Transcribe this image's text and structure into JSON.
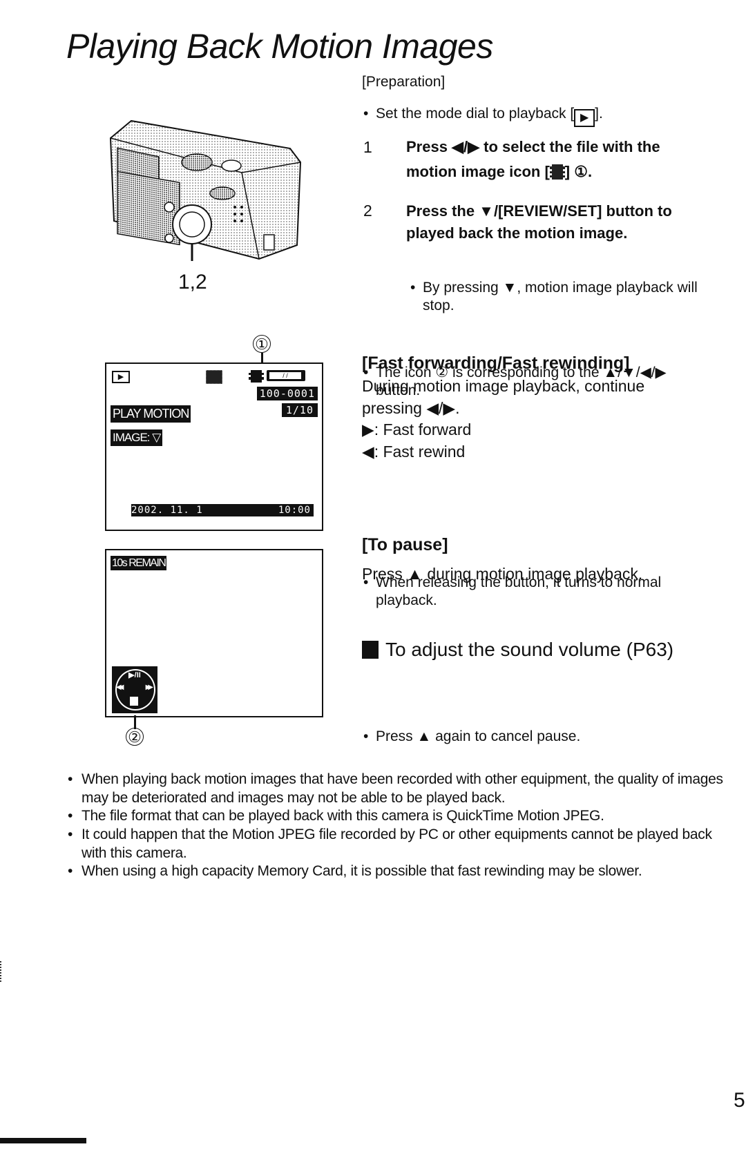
{
  "title": "Playing Back Motion Images",
  "preparation": {
    "label": "[Preparation]",
    "bullet": "Set the mode dial to playback [",
    "bullet_icon": "▶",
    "bullet_end": "]."
  },
  "steps": [
    {
      "num": "1",
      "text_a": "Press ◀/▶ to select the file with the",
      "text_b": "motion image icon [",
      "icon": "film-icon",
      "text_c": "] ①."
    },
    {
      "num": "2",
      "text_a": "Press the ▼/[REVIEW/SET] button to",
      "text_b": "played back the motion image.",
      "sub_bullet_a": "By pressing ▼, motion image playback will",
      "sub_bullet_b": "stop."
    }
  ],
  "icon_note_a": "The icon ② is corresponding to the ▲/▼/◀/▶",
  "icon_note_b": "button.",
  "fast": {
    "heading": "[Fast forwarding/Fast rewinding]",
    "line1": "During motion image playback, continue",
    "line2": "pressing ◀/▶.",
    "ff": "▶: Fast forward",
    "rw": "◀: Fast rewind",
    "note_a": "When releasing the button, it turns to normal",
    "note_b": "playback."
  },
  "pause": {
    "heading": "[To pause]",
    "line": "Press ▲ during motion image playback.",
    "note": "Press ▲ again to cancel pause."
  },
  "volume": {
    "text": "To adjust the sound volume (P63)"
  },
  "camera": {
    "callout_label": "1,2"
  },
  "lcd1": {
    "mode_icon": "▶",
    "file_number": "100-0001",
    "frame_count": "1/10",
    "play_motion": "PLAY MOTION",
    "image_prompt": "IMAGE: ▽",
    "date": "2002. 11. 1",
    "time": "10:00",
    "callout": "①"
  },
  "lcd2": {
    "remain": "10s REMAIN",
    "callout": "②",
    "control_play_pause": "▶/II",
    "control_rewind": "◀◀",
    "control_ff": "▶▶",
    "control_stop": "■"
  },
  "notes": [
    "When playing back motion images that have been recorded with other equipment, the quality of images may be deteriorated and images may not be able to be played back.",
    "The file format that can be played back with this camera is QuickTime Motion JPEG.",
    "It could happen that the Motion JPEG file recorded by PC or other equipments cannot be played back with this camera.",
    "When using a high capacity Memory Card, it is possible that fast rewinding may be slower."
  ],
  "page_number": "5"
}
